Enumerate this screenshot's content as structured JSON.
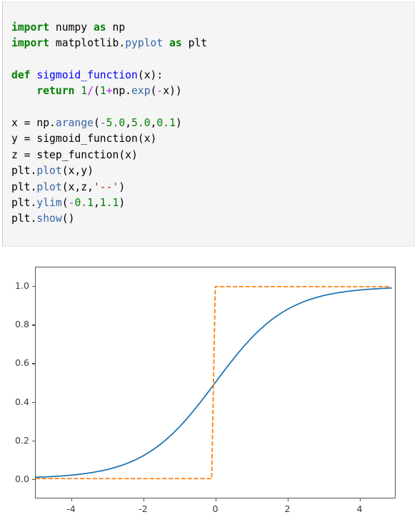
{
  "code_cell": {
    "language": "python",
    "lines": [
      [
        {
          "t": "import",
          "c": "kw"
        },
        {
          "t": " numpy ",
          "c": "pl"
        },
        {
          "t": "as",
          "c": "kw"
        },
        {
          "t": " np",
          "c": "pl"
        }
      ],
      [
        {
          "t": "import",
          "c": "kw"
        },
        {
          "t": " matplotlib.",
          "c": "pl"
        },
        {
          "t": "pyplot",
          "c": "fn"
        },
        {
          "t": " ",
          "c": "pl"
        },
        {
          "t": "as",
          "c": "kw"
        },
        {
          "t": " plt",
          "c": "pl"
        }
      ],
      [],
      [
        {
          "t": "def",
          "c": "kw"
        },
        {
          "t": " ",
          "c": "pl"
        },
        {
          "t": "sigmoid_function",
          "c": "nm"
        },
        {
          "t": "(x):",
          "c": "pl"
        }
      ],
      [
        {
          "t": "    ",
          "c": "pl"
        },
        {
          "t": "return",
          "c": "kw"
        },
        {
          "t": " ",
          "c": "pl"
        },
        {
          "t": "1",
          "c": "num"
        },
        {
          "t": "/",
          "c": "op"
        },
        {
          "t": "(",
          "c": "pl"
        },
        {
          "t": "1",
          "c": "num"
        },
        {
          "t": "+",
          "c": "op"
        },
        {
          "t": "np.",
          "c": "pl"
        },
        {
          "t": "exp",
          "c": "fn"
        },
        {
          "t": "(",
          "c": "pl"
        },
        {
          "t": "-",
          "c": "op"
        },
        {
          "t": "x))",
          "c": "pl"
        }
      ],
      [],
      [
        {
          "t": "x = np.",
          "c": "pl"
        },
        {
          "t": "arange",
          "c": "fn"
        },
        {
          "t": "(",
          "c": "pl"
        },
        {
          "t": "-",
          "c": "op"
        },
        {
          "t": "5.0",
          "c": "num"
        },
        {
          "t": ",",
          "c": "pl"
        },
        {
          "t": "5.0",
          "c": "num"
        },
        {
          "t": ",",
          "c": "pl"
        },
        {
          "t": "0.1",
          "c": "num"
        },
        {
          "t": ")",
          "c": "pl"
        }
      ],
      [
        {
          "t": "y = sigmoid_function(x)",
          "c": "pl"
        }
      ],
      [
        {
          "t": "z = step_function(x)",
          "c": "pl"
        }
      ],
      [
        {
          "t": "plt.",
          "c": "pl"
        },
        {
          "t": "plot",
          "c": "fn"
        },
        {
          "t": "(x,y)",
          "c": "pl"
        }
      ],
      [
        {
          "t": "plt.",
          "c": "pl"
        },
        {
          "t": "plot",
          "c": "fn"
        },
        {
          "t": "(x,z,",
          "c": "pl"
        },
        {
          "t": "'--'",
          "c": "str"
        },
        {
          "t": ")",
          "c": "pl"
        }
      ],
      [
        {
          "t": "plt.",
          "c": "pl"
        },
        {
          "t": "ylim",
          "c": "fn"
        },
        {
          "t": "(",
          "c": "pl"
        },
        {
          "t": "-",
          "c": "op"
        },
        {
          "t": "0.1",
          "c": "num"
        },
        {
          "t": ",",
          "c": "pl"
        },
        {
          "t": "1.1",
          "c": "num"
        },
        {
          "t": ")",
          "c": "pl"
        }
      ],
      [
        {
          "t": "plt.",
          "c": "pl"
        },
        {
          "t": "show",
          "c": "fn"
        },
        {
          "t": "()",
          "c": "pl"
        }
      ]
    ],
    "plain_text": "import numpy as np\nimport matplotlib.pyplot as plt\n\ndef sigmoid_function(x):\n    return 1/(1+np.exp(-x))\n\nx = np.arange(-5.0,5.0,0.1)\ny = sigmoid_function(x)\nz = step_function(x)\nplt.plot(x,y)\nplt.plot(x,z,'--')\nplt.ylim(-0.1,1.1)\nplt.show()"
  },
  "chart_data": {
    "type": "line",
    "title": "",
    "xlabel": "",
    "ylabel": "",
    "xlim": [
      -5.0,
      5.0
    ],
    "ylim": [
      -0.1,
      1.1
    ],
    "grid": false,
    "legend": null,
    "xticks": [
      "-4",
      "-2",
      "0",
      "2",
      "4"
    ],
    "xtick_values": [
      -4,
      -2,
      0,
      2,
      4
    ],
    "yticks": [
      "0.0",
      "0.2",
      "0.4",
      "0.6",
      "0.8",
      "1.0"
    ],
    "ytick_values": [
      0.0,
      0.2,
      0.4,
      0.6,
      0.8,
      1.0
    ],
    "series": [
      {
        "name": "sigmoid_function(x)",
        "color": "#1f77b4",
        "linestyle": "solid",
        "linewidth": 1.8,
        "x": [
          -5.0,
          -4.8,
          -4.6,
          -4.4,
          -4.2,
          -4.0,
          -3.8,
          -3.6,
          -3.4,
          -3.2,
          -3.0,
          -2.8,
          -2.6,
          -2.4,
          -2.2,
          -2.0,
          -1.8,
          -1.6,
          -1.4,
          -1.2,
          -1.0,
          -0.8,
          -0.6,
          -0.4,
          -0.2,
          0.0,
          0.2,
          0.4,
          0.6,
          0.8,
          1.0,
          1.2,
          1.4,
          1.6,
          1.8,
          2.0,
          2.2,
          2.4,
          2.6,
          2.8,
          3.0,
          3.2,
          3.4,
          3.6,
          3.8,
          4.0,
          4.2,
          4.4,
          4.6,
          4.8,
          4.9
        ],
        "values": [
          0.0067,
          0.0082,
          0.01,
          0.0121,
          0.0148,
          0.018,
          0.0219,
          0.0266,
          0.0323,
          0.0392,
          0.0474,
          0.0573,
          0.0691,
          0.0832,
          0.0998,
          0.1192,
          0.1419,
          0.168,
          0.1978,
          0.2315,
          0.2689,
          0.31,
          0.3543,
          0.4013,
          0.4502,
          0.5,
          0.5498,
          0.5987,
          0.6457,
          0.69,
          0.7311,
          0.7685,
          0.8022,
          0.832,
          0.8581,
          0.8808,
          0.9002,
          0.9168,
          0.9309,
          0.9427,
          0.9526,
          0.9608,
          0.9677,
          0.9734,
          0.9781,
          0.982,
          0.9852,
          0.9879,
          0.99,
          0.9918,
          0.9926
        ]
      },
      {
        "name": "step_function(x)",
        "color": "#ff7f0e",
        "linestyle": "dashed",
        "linewidth": 1.8,
        "x": [
          -5.0,
          -0.1,
          0.0,
          4.9
        ],
        "values": [
          0.0,
          0.0,
          1.0,
          1.0
        ]
      }
    ]
  }
}
